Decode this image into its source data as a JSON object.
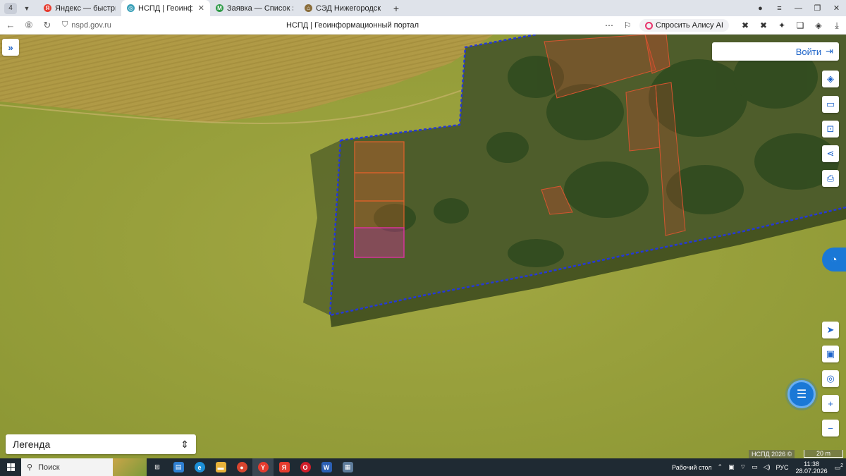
{
  "browser": {
    "tab_count": "4",
    "tabs": [
      {
        "title": "Яндекс — быстрый поиск",
        "favicon_color": "#e63b2e",
        "favicon_glyph": "Я",
        "active": false
      },
      {
        "title": "НСПД | Геоинформацио",
        "favicon_color": "#3aa0b8",
        "favicon_glyph": "◎",
        "active": true
      },
      {
        "title": "Заявка — Список заявок",
        "favicon_color": "#2f9a47",
        "favicon_glyph": "M",
        "active": false
      },
      {
        "title": "СЭД Нижегородская обл",
        "favicon_color": "#8a6d3b",
        "favicon_glyph": "⌂",
        "active": false
      }
    ],
    "url": "nspd.gov.ru",
    "page_title": "НСПД | Геоинформационный портал",
    "alice_label": "Спросить Алису AI"
  },
  "map": {
    "login_label": "Войти",
    "legend_label": "Легенда",
    "copyright": "НСПД 2026 ©",
    "scale_label": "20 m"
  },
  "taskbar": {
    "search_placeholder": "Поиск",
    "desktop_label": "Рабочий стол",
    "lang": "РУС",
    "time": "11:38",
    "date": "28.07.2026",
    "notification_count": "2"
  },
  "colors": {
    "accent": "#1c63c9",
    "boundary": "#2438d8",
    "parcel_orange": "#e0622a",
    "parcel_selected": "#d4349a"
  }
}
